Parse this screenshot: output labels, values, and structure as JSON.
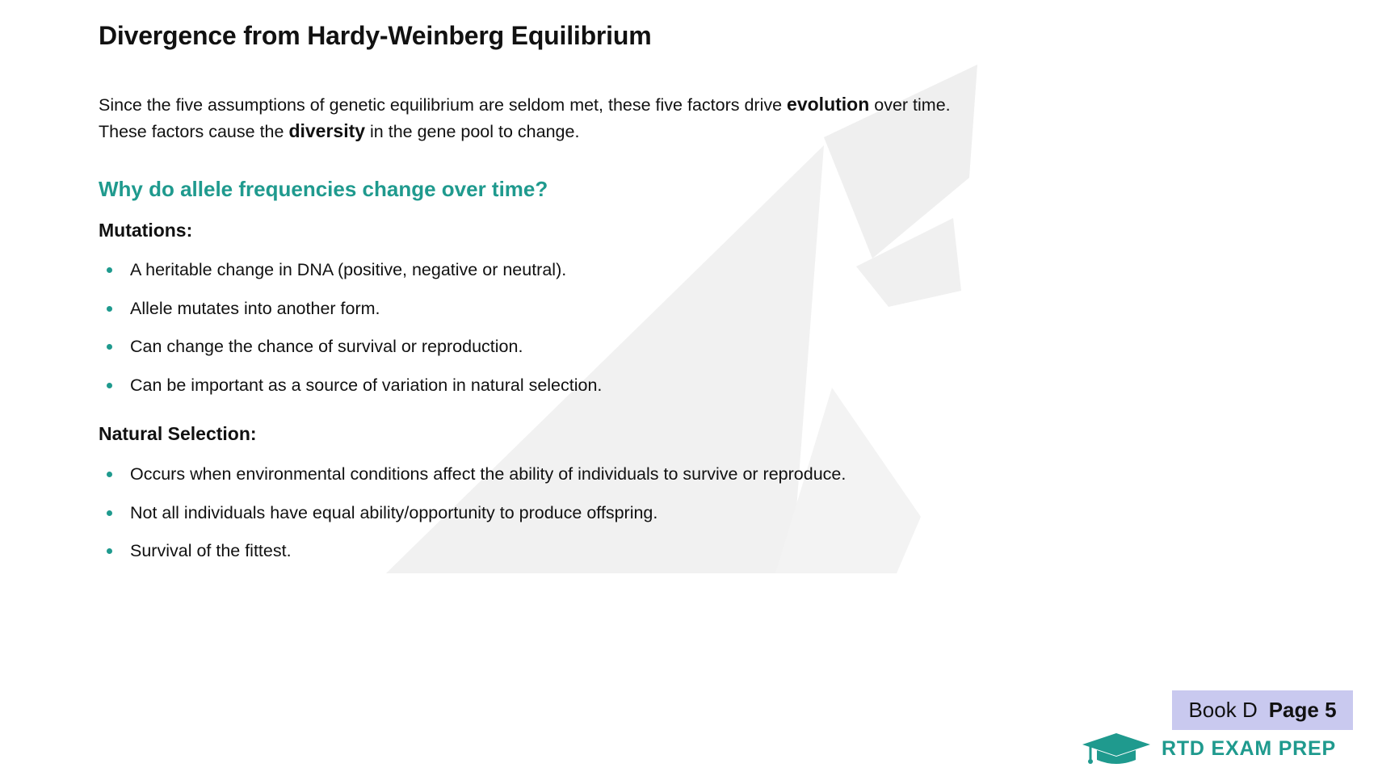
{
  "slide": {
    "title": "Divergence from Hardy-Weinberg Equilibrium",
    "intro": {
      "line1_a": "Since the five assumptions of genetic equilibrium are seldom met, these five factors drive ",
      "line1_bold": "evolution",
      "line1_b": " over time.",
      "line2_a": "These factors cause the ",
      "line2_bold": "diversity",
      "line2_b": " in the gene pool to change."
    },
    "question": "Why do allele frequencies change over time?",
    "sections": [
      {
        "heading": "Mutations:",
        "bullets": [
          "A heritable change in DNA (positive, negative or neutral).",
          "Allele mutates into another form.",
          "Can change the chance of survival or reproduction.",
          "Can be important as a source of variation in natural selection."
        ]
      },
      {
        "heading": "Natural Selection:",
        "bullets": [
          "Occurs when environmental conditions affect the ability of individuals to survive or reproduce.",
          "Not all individuals have equal ability/opportunity to produce offspring.",
          "Survival of the fittest."
        ]
      }
    ]
  },
  "badge": {
    "book": "Book D",
    "page": "Page 5"
  },
  "logo": {
    "text": "RTD EXAM PREP",
    "icon": "graduation-cap-icon"
  },
  "colors": {
    "accent": "#1f9a8e",
    "badge_bg": "#c9c9ef",
    "text": "#111111",
    "watermark": "#eeeeee"
  }
}
